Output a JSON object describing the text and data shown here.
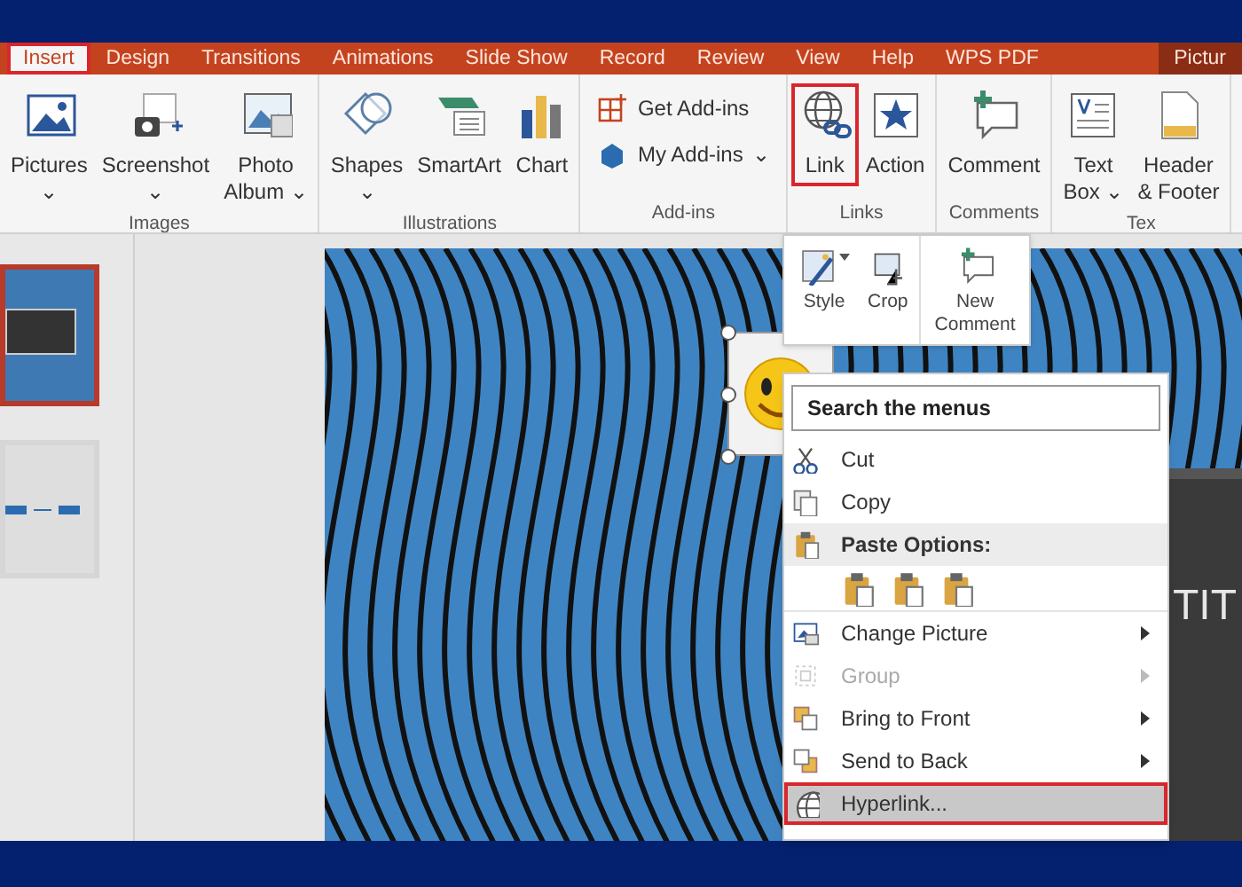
{
  "tabs": [
    {
      "label": "Insert",
      "selected": true,
      "highlighted": true,
      "contextual": false
    },
    {
      "label": "Design",
      "selected": false,
      "highlighted": false,
      "contextual": false
    },
    {
      "label": "Transitions",
      "selected": false,
      "highlighted": false,
      "contextual": false
    },
    {
      "label": "Animations",
      "selected": false,
      "highlighted": false,
      "contextual": false
    },
    {
      "label": "Slide Show",
      "selected": false,
      "highlighted": false,
      "contextual": false
    },
    {
      "label": "Record",
      "selected": false,
      "highlighted": false,
      "contextual": false
    },
    {
      "label": "Review",
      "selected": false,
      "highlighted": false,
      "contextual": false
    },
    {
      "label": "View",
      "selected": false,
      "highlighted": false,
      "contextual": false
    },
    {
      "label": "Help",
      "selected": false,
      "highlighted": false,
      "contextual": false
    },
    {
      "label": "WPS PDF",
      "selected": false,
      "highlighted": false,
      "contextual": false
    },
    {
      "label": "Pictur",
      "selected": false,
      "highlighted": false,
      "contextual": true
    }
  ],
  "ribbon_groups": [
    {
      "label": "Images",
      "buttons": [
        {
          "kind": "large",
          "lines": [
            "Pictures",
            "⌄"
          ],
          "highlighted": false
        },
        {
          "kind": "large",
          "lines": [
            "Screenshot",
            "⌄"
          ],
          "highlighted": false
        },
        {
          "kind": "large",
          "lines": [
            "Photo",
            "Album ⌄"
          ],
          "highlighted": false
        }
      ]
    },
    {
      "label": "Illustrations",
      "buttons": [
        {
          "kind": "large",
          "lines": [
            "Shapes",
            "⌄"
          ],
          "highlighted": false
        },
        {
          "kind": "large",
          "lines": [
            "SmartArt"
          ],
          "highlighted": false
        },
        {
          "kind": "large",
          "lines": [
            "Chart"
          ],
          "highlighted": false
        }
      ]
    },
    {
      "label": "Add-ins",
      "buttons": [
        {
          "kind": "small",
          "lines": [
            "Get Add-ins"
          ],
          "highlighted": false
        },
        {
          "kind": "small",
          "lines": [
            "My Add-ins",
            "⌄"
          ],
          "highlighted": false
        }
      ]
    },
    {
      "label": "Links",
      "buttons": [
        {
          "kind": "large",
          "lines": [
            "Link"
          ],
          "highlighted": true
        },
        {
          "kind": "large",
          "lines": [
            "Action"
          ],
          "highlighted": false
        }
      ]
    },
    {
      "label": "Comments",
      "buttons": [
        {
          "kind": "large",
          "lines": [
            "Comment"
          ],
          "highlighted": false
        }
      ]
    },
    {
      "label": "Tex",
      "buttons": [
        {
          "kind": "large",
          "lines": [
            "Text",
            "Box ⌄"
          ],
          "highlighted": false
        },
        {
          "kind": "large",
          "lines": [
            "Header",
            "& Footer"
          ],
          "highlighted": false
        }
      ]
    }
  ],
  "slides": [
    {
      "selected": true,
      "kind": "title"
    },
    {
      "selected": false,
      "kind": "diagram"
    }
  ],
  "slide": {
    "title_text": "TIT"
  },
  "mini_toolbar": [
    {
      "lines": [
        "Style"
      ],
      "dropdown": true
    },
    {
      "lines": [
        "Crop"
      ],
      "dropdown": false
    },
    {
      "lines": [
        "New",
        "Comment"
      ],
      "dropdown": false
    }
  ],
  "context_menu": {
    "search": {
      "placeholder": "Search the menus"
    },
    "items": [
      {
        "kind": "item",
        "label": "Cut",
        "disabled": false,
        "submenu": false,
        "highlighted": false
      },
      {
        "kind": "item",
        "label": "Copy",
        "disabled": false,
        "submenu": false,
        "highlighted": false
      },
      {
        "kind": "header",
        "label": "Paste Options:",
        "disabled": false,
        "submenu": false,
        "highlighted": false
      },
      {
        "kind": "paste_icons"
      },
      {
        "kind": "item",
        "label": "Change Picture",
        "disabled": false,
        "submenu": true,
        "highlighted": false
      },
      {
        "kind": "item",
        "label": "Group",
        "disabled": true,
        "submenu": true,
        "highlighted": false
      },
      {
        "kind": "item",
        "label": "Bring to Front",
        "disabled": false,
        "submenu": true,
        "highlighted": false
      },
      {
        "kind": "item",
        "label": "Send to Back",
        "disabled": false,
        "submenu": true,
        "highlighted": false
      },
      {
        "kind": "item",
        "label": "Hyperlink...",
        "disabled": false,
        "submenu": false,
        "highlighted": true
      }
    ]
  }
}
